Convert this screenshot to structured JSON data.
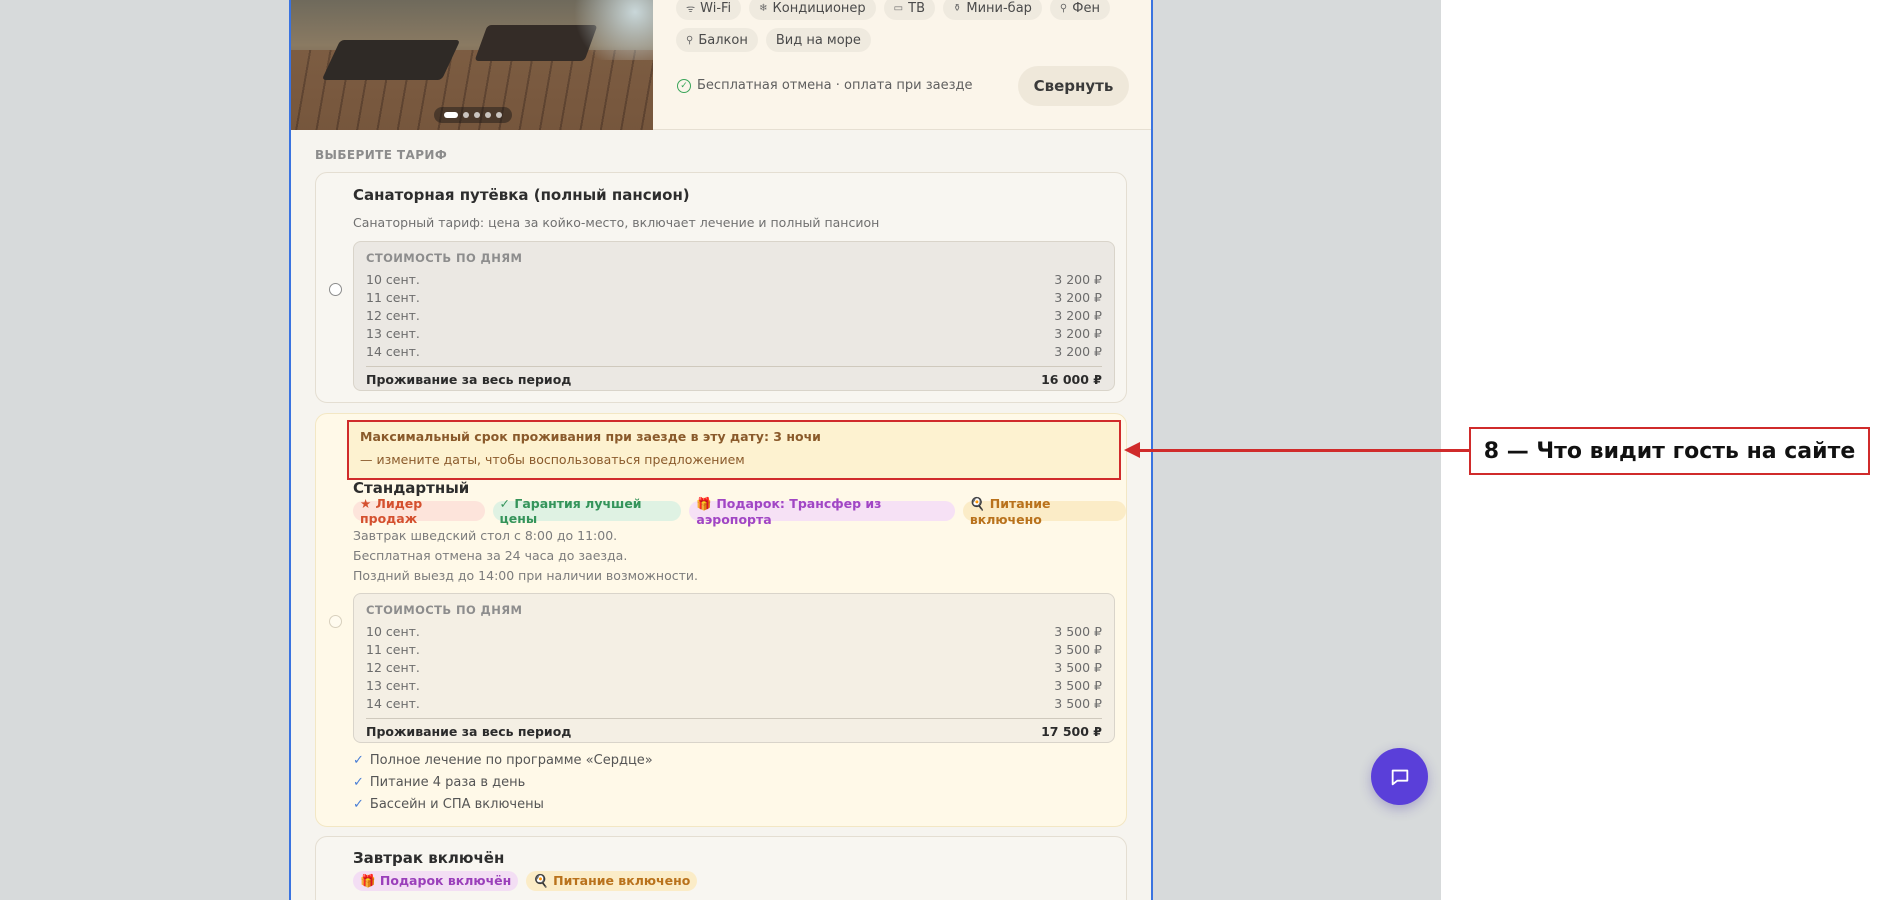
{
  "room": {
    "amenities": [
      {
        "icon": "wifi-icon",
        "glyph": "ᯤ",
        "label": "Wi-Fi"
      },
      {
        "icon": "snowflake-icon",
        "glyph": "❄",
        "label": "Кондиционер"
      },
      {
        "icon": "tv-icon",
        "glyph": "▭",
        "label": "ТВ"
      },
      {
        "icon": "minibar-icon",
        "glyph": "⚱",
        "label": "Мини-бар"
      },
      {
        "icon": "hairdryer-icon",
        "glyph": "⚲",
        "label": "Фен"
      },
      {
        "icon": "balcony-icon",
        "glyph": "⚲",
        "label": "Балкон"
      },
      {
        "icon": "",
        "glyph": "",
        "label": "Вид на море"
      }
    ],
    "free_cancel": "Бесплатная отмена · оплата при заезде",
    "collapse_label": "Свернуть",
    "photo_slides": 5,
    "photo_active": 1
  },
  "section_title": "ВЫБЕРИТЕ ТАРИФ",
  "tariff1": {
    "title": "Санаторная путёвка (полный пансион)",
    "subtitle": "Санаторный тариф: цена за койко-место, включает лечение и полный пансион",
    "price_head": "СТОИМОСТЬ ПО ДНЯМ",
    "days": [
      {
        "date": "10 сент.",
        "price": "3 200 ₽"
      },
      {
        "date": "11 сент.",
        "price": "3 200 ₽"
      },
      {
        "date": "12 сент.",
        "price": "3 200 ₽"
      },
      {
        "date": "13 сент.",
        "price": "3 200 ₽"
      },
      {
        "date": "14 сент.",
        "price": "3 200 ₽"
      }
    ],
    "total_label": "Проживание за весь период",
    "total_value": "16 000 ₽"
  },
  "warning": {
    "line1": "Максимальный срок проживания при заезде в эту дату: 3 ночи",
    "line2": "— измените даты, чтобы воспользоваться предложением"
  },
  "tariff2": {
    "title": "Стандартный",
    "badges": [
      {
        "label": "★ Лидер продаж"
      },
      {
        "label": "✓ Гарантия лучшей цены"
      },
      {
        "label": "🎁 Подарок: Трансфер из аэропорта"
      },
      {
        "label": "🍳 Питание включено"
      }
    ],
    "lines": [
      "Завтрак шведский стол с 8:00 до 11:00.",
      "Бесплатная отмена за 24 часа до заезда.",
      "Поздний выезд до 14:00 при наличии возможности."
    ],
    "price_head": "СТОИМОСТЬ ПО ДНЯМ",
    "days": [
      {
        "date": "10 сент.",
        "price": "3 500 ₽"
      },
      {
        "date": "11 сент.",
        "price": "3 500 ₽"
      },
      {
        "date": "12 сент.",
        "price": "3 500 ₽"
      },
      {
        "date": "13 сент.",
        "price": "3 500 ₽"
      },
      {
        "date": "14 сент.",
        "price": "3 500 ₽"
      }
    ],
    "total_label": "Проживание за весь период",
    "total_value": "17 500 ₽",
    "features": [
      "Полное лечение по программе «Сердце»",
      "Питание 4 раза в день",
      "Бассейн и СПА включены"
    ]
  },
  "tariff3": {
    "title": "Завтрак включён",
    "badges": [
      {
        "label": "🎁 Подарок включён"
      },
      {
        "label": "🍳 Питание включено"
      }
    ]
  },
  "annotation": "8 — Что видит гость на сайте"
}
